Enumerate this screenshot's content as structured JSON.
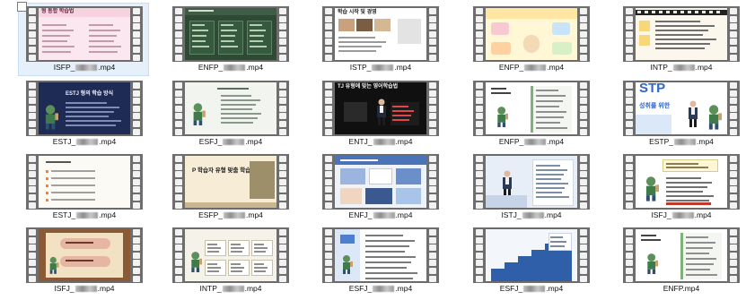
{
  "files": [
    {
      "prefix": "ISFP_",
      "suffix": ".mp4",
      "selected": true,
      "style": "pink-title",
      "title": "형 통합 학습법"
    },
    {
      "prefix": "ENFP_",
      "suffix": ".mp4",
      "selected": false,
      "style": "green-board"
    },
    {
      "prefix": "ISTP_",
      "suffix": ".mp4",
      "selected": false,
      "style": "white-photos",
      "title": "학습 시작 및 경영"
    },
    {
      "prefix": "ENFP_",
      "suffix": ".mp4",
      "selected": false,
      "style": "cartoon-yellow"
    },
    {
      "prefix": "INTP_",
      "suffix": ".mp4",
      "selected": false,
      "style": "film-strip-text"
    },
    {
      "prefix": "ESTJ_",
      "suffix": ".mp4",
      "selected": false,
      "style": "navy-cartoon",
      "title": "ESTJ 형의 학습 방식"
    },
    {
      "prefix": "ESFJ_",
      "suffix": ".mp4",
      "selected": false,
      "style": "pale-cartoon"
    },
    {
      "prefix": "ENTJ_",
      "suffix": ".mp4",
      "selected": false,
      "style": "black-person",
      "title": "TJ 유형에 맞는 영어학습법"
    },
    {
      "prefix": "ENFP_",
      "suffix": ".mp4",
      "selected": false,
      "style": "white-cartoon-list"
    },
    {
      "prefix": "ESTP_",
      "suffix": ".mp4",
      "selected": false,
      "style": "estp-blue",
      "title": "STP",
      "subtitle": "성취를 위한"
    },
    {
      "prefix": "ESTJ_",
      "suffix": ".mp4",
      "selected": false,
      "style": "plain-lines"
    },
    {
      "prefix": "ESFP_",
      "suffix": ".mp4",
      "selected": false,
      "style": "cream-title",
      "title": "P 학습자 유형 맞춤 학습법"
    },
    {
      "prefix": "ENFJ_",
      "suffix": ".mp4",
      "selected": false,
      "style": "collage"
    },
    {
      "prefix": "ISTJ_",
      "suffix": ".mp4",
      "selected": false,
      "style": "man-screen"
    },
    {
      "prefix": "ISFJ_",
      "suffix": ".mp4",
      "selected": false,
      "style": "speech-cartoon"
    },
    {
      "prefix": "ISFJ_",
      "suffix": ".mp4",
      "selected": false,
      "style": "brown-book"
    },
    {
      "prefix": "INTP_",
      "suffix": ".mp4",
      "selected": false,
      "style": "cartoon-boxes"
    },
    {
      "prefix": "ESFJ_",
      "suffix": ".mp4",
      "selected": false,
      "style": "blue-left"
    },
    {
      "prefix": "ESFJ_",
      "suffix": ".mp4",
      "selected": false,
      "style": "stairs"
    },
    {
      "prefix": "ENFP",
      "suffix": ".mp4",
      "selected": false,
      "style": "white-cartoon-list",
      "hideBlur": true
    }
  ]
}
